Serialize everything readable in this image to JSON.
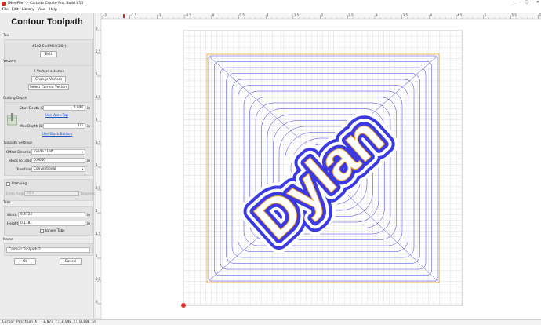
{
  "window": {
    "title": "[NewFile]* - Carbide Create Pro, Build 855",
    "controls": [
      "—",
      "□",
      "✕"
    ]
  },
  "menu": [
    "File",
    "Edit",
    "Library",
    "View",
    "Help"
  ],
  "panel": {
    "heading": "Contour Toolpath",
    "tool": {
      "section": "Tool",
      "name": "#102 End Mill (1/8\")",
      "edit_label": "Edit"
    },
    "vectors": {
      "section": "Vectors",
      "status": "2 Vectors selected",
      "change_label": "Change Vectors",
      "select_label": "Select Current Vectors"
    },
    "depth": {
      "section": "Cutting Depth",
      "start_label": "Start Depth (S)",
      "start_value": "0.000",
      "start_unit": "in",
      "work_top_link": "Use Work Top",
      "max_label": "Max Depth (D)",
      "max_value": "1/2",
      "max_unit": "in",
      "stock_bottom_link": "Use Stock Bottom"
    },
    "settings": {
      "section": "Toolpath Settings",
      "offset_label": "Offset Direction",
      "offset_value": "Inside / Left",
      "stock_label": "Stock to Leave",
      "stock_value": "0.0000",
      "stock_unit": "in",
      "direction_label": "Direction",
      "direction_value": "Conventional"
    },
    "ramping": {
      "label": "Ramping",
      "entry_label": "Entry Angle",
      "entry_value": "20.0",
      "entry_unit": "Degrees"
    },
    "tabs": {
      "section": "Tabs",
      "width_label": "Width",
      "width_value": "0.4724",
      "width_unit": "in",
      "height_label": "Height",
      "height_value": "0.1181",
      "height_unit": "in",
      "ignore_label": "Ignore Tabs"
    },
    "name": {
      "section": "Name",
      "value": "Contour Toolpath 2"
    },
    "ok_label": "Ok",
    "cancel_label": "Cancel"
  },
  "canvas": {
    "design_text": "Dylan",
    "ruler_top": [
      "-2",
      "-1.5",
      "-1",
      "-0.5",
      "0",
      "0.5",
      "1",
      "1.5",
      "2",
      "2.5",
      "3",
      "3.5",
      "4",
      "4.5",
      "5",
      "5.5",
      "6"
    ],
    "ruler_left": [
      "6",
      "5.5",
      "5",
      "4.5",
      "4",
      "3.5",
      "3",
      "2.5",
      "2",
      "1.5",
      "1",
      "0.5",
      "0"
    ],
    "colors": {
      "toolpath": "#3a3ae0",
      "vector": "#f0a030",
      "grid": "#d6d6d6",
      "marker": "#e03030"
    }
  },
  "status": {
    "cursor": "Cursor Position X: -1.073 Y: 3.098 Z: 0.000 in"
  }
}
